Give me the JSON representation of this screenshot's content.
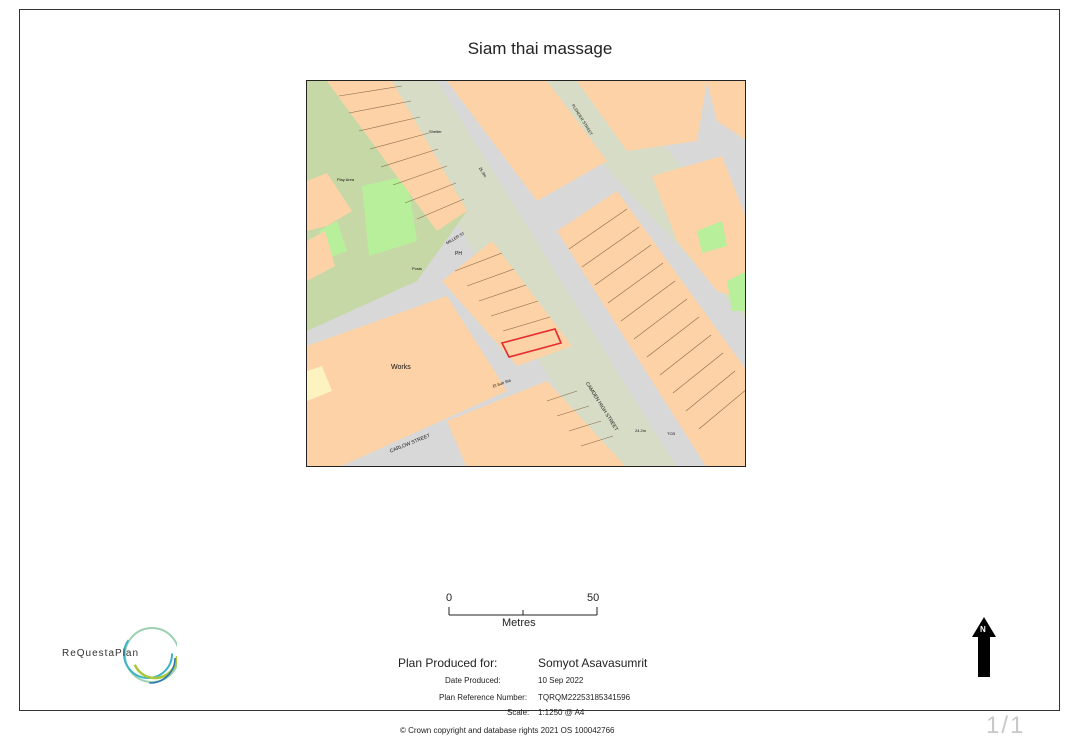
{
  "title": "Siam thai massage",
  "map": {
    "labels": {
      "works": "Works",
      "camden_high_street": "CAMDEN HIGH STREET",
      "carlow_street": "CARLOW STREET",
      "miller_st": "MILLER ST",
      "play_area": "Play Area",
      "shelter": "Shelter",
      "posts": "Posts",
      "ph": "PH",
      "level_left": "25.3m",
      "level_right": "24.2m",
      "tcb": "TCB",
      "elsub": "El Sub Sta",
      "plender": "PLENDER STREET"
    }
  },
  "scale": {
    "start": "0",
    "end": "50",
    "unit": "Metres"
  },
  "logo": {
    "text": "ReQuestaPlan"
  },
  "info": {
    "produced_for_label": "Plan Produced for:",
    "produced_for_value": "Somyot Asavasumrit",
    "date_label": "Date Produced:",
    "date_value": "10 Sep 2022",
    "ref_label": "Plan Reference Number:",
    "ref_value": "TQRQM22253185341596",
    "scale_label": "Scale:",
    "scale_value": "1:1250 @ A4",
    "copyright": "© Crown copyright and database rights 2021 OS 100042766"
  },
  "north": {
    "letter": "N"
  },
  "pager": "1/1",
  "colors": {
    "building": "#fcd2a6",
    "road": "#d9d9d9",
    "green": "#c9e1a6",
    "openland": "#dde6c8",
    "highlight": "#e52b2b"
  }
}
